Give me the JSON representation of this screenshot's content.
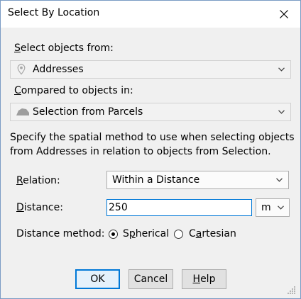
{
  "window": {
    "title": "Select By Location"
  },
  "select_from": {
    "label_key": "S",
    "label_rest": "elect objects from:",
    "value": "Addresses",
    "icon": "map-pin-icon"
  },
  "compare_to": {
    "label_key": "C",
    "label_rest": "ompared to objects in:",
    "value": "Selection from Parcels",
    "icon": "parcel-layer-icon"
  },
  "description": {
    "line1": "Specify the spatial method to use when selecting objects",
    "line2": "from Addresses in relation to objects from Selection."
  },
  "relation": {
    "label_key": "R",
    "label_rest": "elation:",
    "value": "Within a Distance"
  },
  "distance": {
    "label_key": "D",
    "label_rest": "istance:",
    "value": "250",
    "unit": "m"
  },
  "distance_method": {
    "label": "Distance method:",
    "spherical_pre": "S",
    "spherical_key": "p",
    "spherical_post": "herical",
    "cartesian_pre": "C",
    "cartesian_key": "a",
    "cartesian_post": "rtesian",
    "selected": "Spherical"
  },
  "buttons": {
    "ok": "OK",
    "cancel": "Cancel",
    "help_key": "H",
    "help_rest": "elp"
  },
  "colors": {
    "focus_blue": "#0078d7",
    "dialog_bg": "#f0f0f0"
  }
}
